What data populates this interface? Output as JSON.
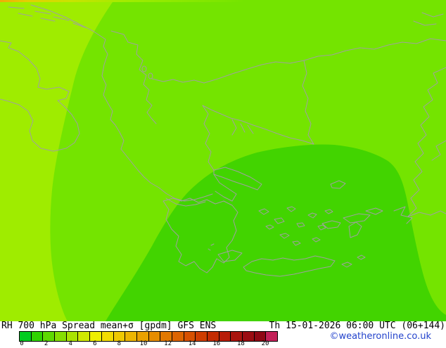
{
  "map": {
    "region_colors": {
      "base": "#74e400",
      "left": "#9fec00",
      "dome": "#42d400"
    },
    "border_color": "#a0a0a0",
    "region_names": {
      "base": "mid-spread green area",
      "left": "low-spread yellow-green area",
      "dome": "higher-spread dark green dome"
    }
  },
  "caption": {
    "left": "RH 700 hPa Spread mean+σ [gpdm] GFS ENS",
    "right": "Th 15-01-2026 06:00 UTC (06+144)"
  },
  "colorbar": {
    "unit": "gpdm",
    "ticks": [
      "0",
      "2",
      "4",
      "6",
      "8",
      "10",
      "12",
      "14",
      "16",
      "18",
      "20"
    ],
    "colors": [
      "#00cc1f",
      "#30d300",
      "#5ed900",
      "#86de00",
      "#aae300",
      "#cfe900",
      "#eeee00",
      "#f2dc00",
      "#efc900",
      "#ecb500",
      "#e9a100",
      "#e68d00",
      "#e27900",
      "#dd6500",
      "#d75100",
      "#cf3d00",
      "#c42c02",
      "#b81d08",
      "#a9140e",
      "#9b0c12",
      "#8f0714",
      "#c32058"
    ]
  },
  "copyright": {
    "text": "©weatheronline.co.uk",
    "color": "#2343cc"
  }
}
